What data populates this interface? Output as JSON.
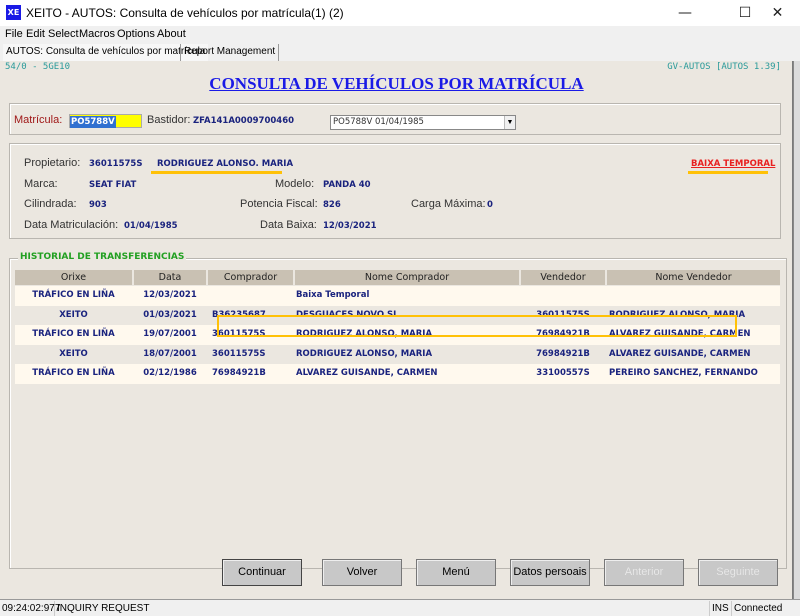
{
  "window": {
    "app_icon": "XE",
    "title": "XEITO - AUTOS: Consulta de vehículos por matrícula(1) (2)",
    "controls": {
      "minimize": "—",
      "maximize": "☐",
      "close": "✕"
    }
  },
  "menu": [
    "File",
    "Edit",
    "Select",
    "Macros",
    "Options",
    "About"
  ],
  "tabs": [
    {
      "label": "AUTOS: Consulta de vehículos por matrícula",
      "active": true
    },
    {
      "label": "Report Management",
      "active": false
    }
  ],
  "screen": {
    "id": "54/0 - 5GE10",
    "version": "GV-AUTOS [AUTOS 1.39]",
    "title": "CONSULTA DE VEHÍCULOS POR MATRÍCULA"
  },
  "search": {
    "matricula_label": "Matrícula:",
    "matricula_value": "PO5788V",
    "bastidor_label": "Bastidor:",
    "bastidor_value": "ZFA141A0009700460",
    "dropdown_selected": "PO5788V 01/04/1985"
  },
  "info": {
    "propietario_label": "Propietario:",
    "propietario_id": "36011575S",
    "propietario_name": "RODRIGUEZ ALONSO. MARIA",
    "status": "BAIXA TEMPORAL",
    "marca_label": "Marca:",
    "marca": "SEAT FIAT",
    "modelo_label": "Modelo:",
    "modelo": "PANDA 40",
    "cilindrada_label": "Cilindrada:",
    "cilindrada": "903",
    "potencia_label": "Potencia Fiscal:",
    "potencia": "826",
    "carga_label": "Carga Máxima:",
    "carga": "0",
    "data_matriculacion_label": "Data Matriculación:",
    "data_matriculacion": "01/04/1985",
    "data_baixa_label": "Data Baixa:",
    "data_baixa": "12/03/2021"
  },
  "historial": {
    "title": "HISTORIAL DE TRANSFERENCIAS",
    "columns": [
      "Orixe",
      "Data",
      "Comprador",
      "Nome Comprador",
      "Vendedor",
      "Nome Vendedor"
    ],
    "rows": [
      [
        "TRÁFICO EN LIÑA",
        "12/03/2021",
        "",
        "Baixa Temporal",
        "",
        ""
      ],
      [
        "XEITO",
        "01/03/2021",
        "B36235687",
        "DESGUACES NOVO SL",
        "36011575S",
        "RODRIGUEZ ALONSO, MARIA"
      ],
      [
        "TRÁFICO EN LIÑA",
        "19/07/2001",
        "36011575S",
        "RODRIGUEZ ALONSO, MARIA",
        "76984921B",
        "ALVAREZ GUISANDE, CARMEN"
      ],
      [
        "XEITO",
        "18/07/2001",
        "36011575S",
        "RODRIGUEZ ALONSO, MARIA",
        "76984921B",
        "ALVAREZ GUISANDE, CARMEN"
      ],
      [
        "TRÁFICO EN LIÑA",
        "02/12/1986",
        "76984921B",
        "ALVAREZ GUISANDE, CARMEN",
        "33100557S",
        "PEREIRO SANCHEZ, FERNANDO"
      ]
    ]
  },
  "buttons": {
    "continuar": "Continuar",
    "volver": "Volver",
    "menu": "Menú",
    "datos_persoais": "Datos persoais",
    "anterior": "Anterior",
    "seguinte": "Seguinte"
  },
  "statusbar": {
    "time": "09:24:02:977",
    "message": "INQUIRY REQUEST",
    "mode": "INS",
    "connection": "Connected"
  }
}
